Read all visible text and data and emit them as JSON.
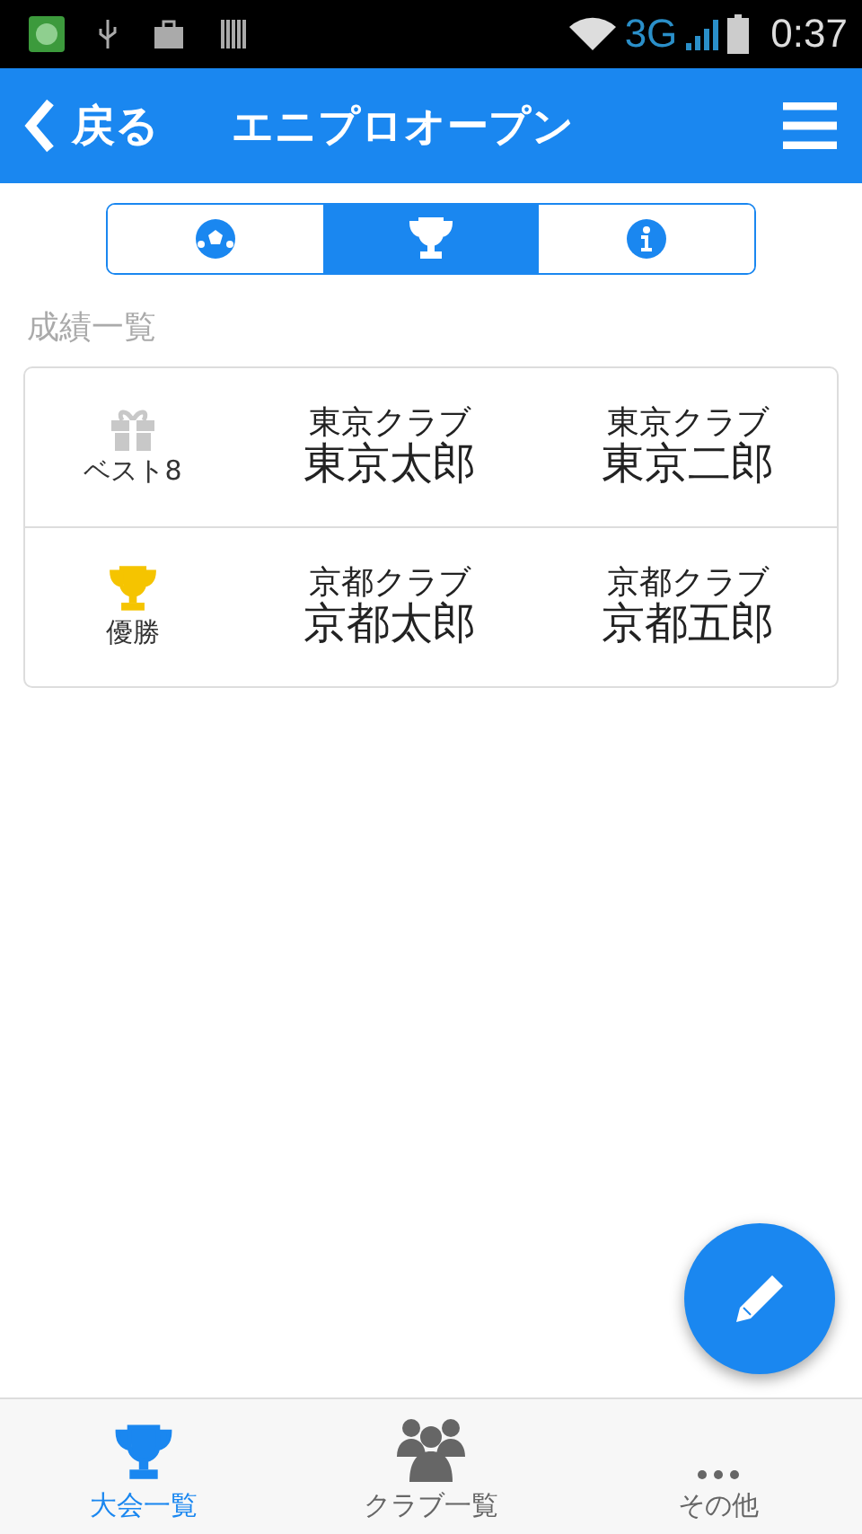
{
  "status_bar": {
    "network": "3G",
    "time": "0:37"
  },
  "header": {
    "back": "戻る",
    "title": "エニプロオープン"
  },
  "segments": [
    {
      "kind": "ball",
      "selected": false
    },
    {
      "kind": "trophy",
      "selected": true
    },
    {
      "kind": "info",
      "selected": false
    }
  ],
  "section_title": "成績一覧",
  "results": [
    {
      "kind": "gift",
      "award": "ベスト8",
      "players": [
        {
          "club": "東京クラブ",
          "name": "東京太郎"
        },
        {
          "club": "東京クラブ",
          "name": "東京二郎"
        }
      ]
    },
    {
      "kind": "trophy",
      "award": "優勝",
      "players": [
        {
          "club": "京都クラブ",
          "name": "京都太郎"
        },
        {
          "club": "京都クラブ",
          "name": "京都五郎"
        }
      ]
    }
  ],
  "bottom_nav": [
    {
      "kind": "trophy",
      "label": "大会一覧",
      "selected": true
    },
    {
      "kind": "people",
      "label": "クラブ一覧",
      "selected": false
    },
    {
      "kind": "more",
      "label": "その他",
      "selected": false
    }
  ]
}
